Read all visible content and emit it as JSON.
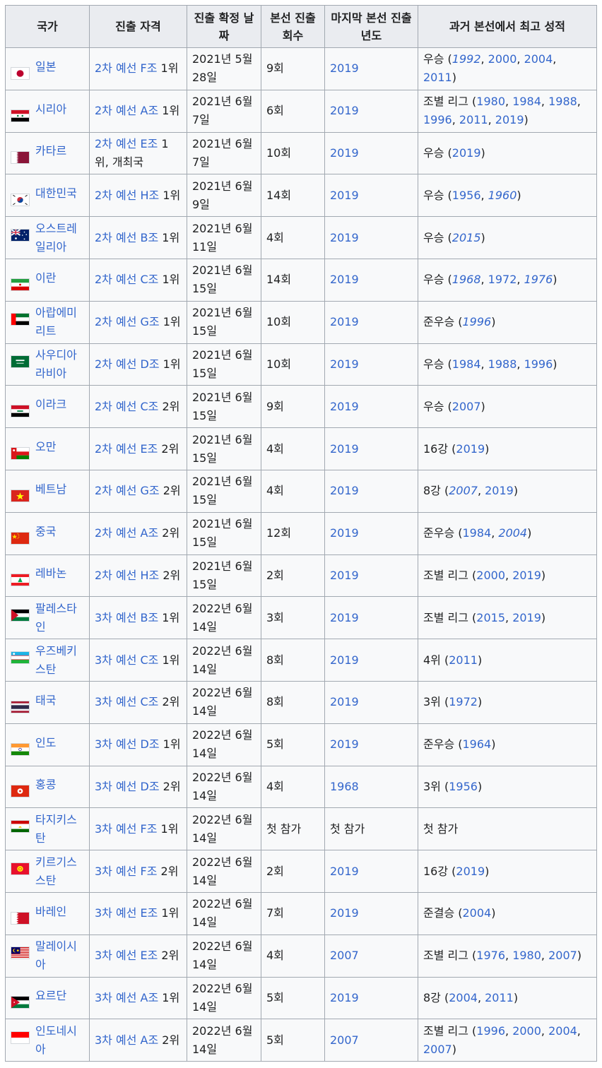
{
  "headers": [
    "국가",
    "진출 자격",
    "진출 확정 날짜",
    "본선 진출 회수",
    "마지막 본선 진출 년도",
    "과거 본선에서 최고 성적"
  ],
  "rows": [
    {
      "flag": "japan",
      "country": "일본",
      "qual": "2차 예선 F조 1위",
      "date": "2021년 5월 28일",
      "count": "9회",
      "last": "2019",
      "last_link": true,
      "best": "우승",
      "years": [
        {
          "y": "1992",
          "i": true
        },
        {
          "y": "2000"
        },
        {
          "y": "2004"
        },
        {
          "y": "2011"
        }
      ]
    },
    {
      "flag": "syria",
      "country": "시리아",
      "qual": "2차 예선 A조 1위",
      "date": "2021년 6월 7일",
      "count": "6회",
      "last": "2019",
      "last_link": true,
      "best": "조별 리그",
      "years": [
        {
          "y": "1980"
        },
        {
          "y": "1984"
        },
        {
          "y": "1988"
        },
        {
          "y": "1996"
        },
        {
          "y": "2011"
        },
        {
          "y": "2019"
        }
      ]
    },
    {
      "flag": "qatar",
      "country": "카타르",
      "qual": "2차 예선 E조 1위, 개최국",
      "date": "2021년 6월 7일",
      "count": "10회",
      "last": "2019",
      "last_link": true,
      "best": "우승",
      "years": [
        {
          "y": "2019"
        }
      ]
    },
    {
      "flag": "korea",
      "country": "대한민국",
      "qual": "2차 예선 H조 1위",
      "date": "2021년 6월 9일",
      "count": "14회",
      "last": "2019",
      "last_link": true,
      "best": "우승",
      "years": [
        {
          "y": "1956"
        },
        {
          "y": "1960",
          "i": true
        }
      ]
    },
    {
      "flag": "australia",
      "country": "오스트레일리아",
      "qual": "2차 예선 B조 1위",
      "date": "2021년 6월 11일",
      "count": "4회",
      "last": "2019",
      "last_link": true,
      "best": "우승",
      "years": [
        {
          "y": "2015",
          "i": true
        }
      ]
    },
    {
      "flag": "iran",
      "country": "이란",
      "qual": "2차 예선 C조 1위",
      "date": "2021년 6월 15일",
      "count": "14회",
      "last": "2019",
      "last_link": true,
      "best": "우승",
      "years": [
        {
          "y": "1968",
          "i": true
        },
        {
          "y": "1972"
        },
        {
          "y": "1976",
          "i": true
        }
      ]
    },
    {
      "flag": "uae",
      "country": "아랍에미리트",
      "qual": "2차 예선 G조 1위",
      "date": "2021년 6월 15일",
      "count": "10회",
      "last": "2019",
      "last_link": true,
      "best": "준우승",
      "years": [
        {
          "y": "1996",
          "i": true
        }
      ]
    },
    {
      "flag": "saudi",
      "country": "사우디아라비아",
      "qual": "2차 예선 D조 1위",
      "date": "2021년 6월 15일",
      "count": "10회",
      "last": "2019",
      "last_link": true,
      "best": "우승",
      "years": [
        {
          "y": "1984"
        },
        {
          "y": "1988"
        },
        {
          "y": "1996"
        }
      ]
    },
    {
      "flag": "iraq",
      "country": "이라크",
      "qual": "2차 예선 C조 2위",
      "date": "2021년 6월 15일",
      "count": "9회",
      "last": "2019",
      "last_link": true,
      "best": "우승",
      "years": [
        {
          "y": "2007"
        }
      ]
    },
    {
      "flag": "oman",
      "country": "오만",
      "qual": "2차 예선 E조 2위",
      "date": "2021년 6월 15일",
      "count": "4회",
      "last": "2019",
      "last_link": true,
      "best": "16강",
      "years": [
        {
          "y": "2019"
        }
      ]
    },
    {
      "flag": "vietnam",
      "country": "베트남",
      "qual": "2차 예선 G조 2위",
      "date": "2021년 6월 15일",
      "count": "4회",
      "last": "2019",
      "last_link": true,
      "best": "8강",
      "years": [
        {
          "y": "2007",
          "i": true
        },
        {
          "y": "2019"
        }
      ]
    },
    {
      "flag": "china",
      "country": "중국",
      "qual": "2차 예선 A조 2위",
      "date": "2021년 6월 15일",
      "count": "12회",
      "last": "2019",
      "last_link": true,
      "best": "준우승",
      "years": [
        {
          "y": "1984"
        },
        {
          "y": "2004",
          "i": true
        }
      ]
    },
    {
      "flag": "lebanon",
      "country": "레바논",
      "qual": "2차 예선 H조 2위",
      "date": "2021년 6월 15일",
      "count": "2회",
      "last": "2019",
      "last_link": true,
      "best": "조별 리그",
      "years": [
        {
          "y": "2000"
        },
        {
          "y": "2019"
        }
      ]
    },
    {
      "flag": "palestine",
      "country": "팔레스타인",
      "qual": "3차 예선 B조 1위",
      "date": "2022년 6월 14일",
      "count": "3회",
      "last": "2019",
      "last_link": true,
      "best": "조별 리그",
      "years": [
        {
          "y": "2015"
        },
        {
          "y": "2019"
        }
      ]
    },
    {
      "flag": "uzbekistan",
      "country": "우즈베키스탄",
      "qual": "3차 예선 C조 1위",
      "date": "2022년 6월 14일",
      "count": "8회",
      "last": "2019",
      "last_link": true,
      "best": "4위",
      "years": [
        {
          "y": "2011"
        }
      ]
    },
    {
      "flag": "thailand",
      "country": "태국",
      "qual": "3차 예선 C조 2위",
      "date": "2022년 6월 14일",
      "count": "8회",
      "last": "2019",
      "last_link": true,
      "best": "3위",
      "years": [
        {
          "y": "1972"
        }
      ]
    },
    {
      "flag": "india",
      "country": "인도",
      "qual": "3차 예선 D조 1위",
      "date": "2022년 6월 14일",
      "count": "5회",
      "last": "2019",
      "last_link": true,
      "best": "준우승",
      "years": [
        {
          "y": "1964"
        }
      ]
    },
    {
      "flag": "hongkong",
      "country": "홍콩",
      "qual": "3차 예선 D조 2위",
      "date": "2022년 6월 14일",
      "count": "4회",
      "last": "1968",
      "last_link": true,
      "best": "3위",
      "years": [
        {
          "y": "1956"
        }
      ]
    },
    {
      "flag": "tajikistan",
      "country": "타지키스탄",
      "qual": "3차 예선 F조 1위",
      "date": "2022년 6월 14일",
      "count": "첫 참가",
      "last": "첫 참가",
      "last_link": false,
      "best": "첫 참가",
      "years": []
    },
    {
      "flag": "kyrgyzstan",
      "country": "키르기스스탄",
      "qual": "3차 예선 F조 2위",
      "date": "2022년 6월 14일",
      "count": "2회",
      "last": "2019",
      "last_link": true,
      "best": "16강",
      "years": [
        {
          "y": "2019"
        }
      ]
    },
    {
      "flag": "bahrain",
      "country": "바레인",
      "qual": "3차 예선 E조 1위",
      "date": "2022년 6월 14일",
      "count": "7회",
      "last": "2019",
      "last_link": true,
      "best": "준결승",
      "years": [
        {
          "y": "2004"
        }
      ]
    },
    {
      "flag": "malaysia",
      "country": "말레이시아",
      "qual": "3차 예선 E조 2위",
      "date": "2022년 6월 14일",
      "count": "4회",
      "last": "2007",
      "last_link": true,
      "best": "조별 리그",
      "years": [
        {
          "y": "1976"
        },
        {
          "y": "1980"
        },
        {
          "y": "2007"
        }
      ]
    },
    {
      "flag": "jordan",
      "country": "요르단",
      "qual": "3차 예선 A조 1위",
      "date": "2022년 6월 14일",
      "count": "5회",
      "last": "2019",
      "last_link": true,
      "best": "8강",
      "years": [
        {
          "y": "2004"
        },
        {
          "y": "2011"
        }
      ]
    },
    {
      "flag": "indonesia",
      "country": "인도네시아",
      "qual": "3차 예선 A조 2위",
      "date": "2022년 6월 14일",
      "count": "5회",
      "last": "2007",
      "last_link": true,
      "best": "조별 리그",
      "years": [
        {
          "y": "1996"
        },
        {
          "y": "2000"
        },
        {
          "y": "2004"
        },
        {
          "y": "2007"
        }
      ]
    }
  ]
}
